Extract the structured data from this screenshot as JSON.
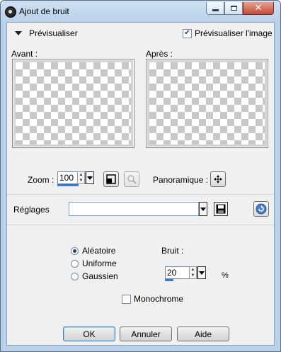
{
  "window": {
    "title": "Ajout de bruit"
  },
  "preview": {
    "toggle_label": "Prévisualiser",
    "show_on_image_label": "Prévisualiser l'image",
    "show_on_image_checked": true,
    "before_label": "Avant :",
    "after_label": "Après :",
    "zoom_label": "Zoom :",
    "zoom_value": "100",
    "pan_label": "Panoramique :"
  },
  "presets": {
    "label": "Réglages",
    "value": ""
  },
  "noise": {
    "options": [
      {
        "label": "Aléatoire",
        "selected": true
      },
      {
        "label": "Uniforme",
        "selected": false
      },
      {
        "label": "Gaussien",
        "selected": false
      }
    ],
    "amount_label": "Bruit :",
    "amount_value": "20",
    "amount_unit": "%",
    "monochrome_label": "Monochrome",
    "monochrome_checked": false
  },
  "buttons": {
    "ok": "OK",
    "cancel": "Annuler",
    "help": "Aide"
  },
  "colors": {
    "title_bar": "#b9d1ea",
    "dialog_bg": "#f0f0f0",
    "accent": "#3a7bd5"
  }
}
